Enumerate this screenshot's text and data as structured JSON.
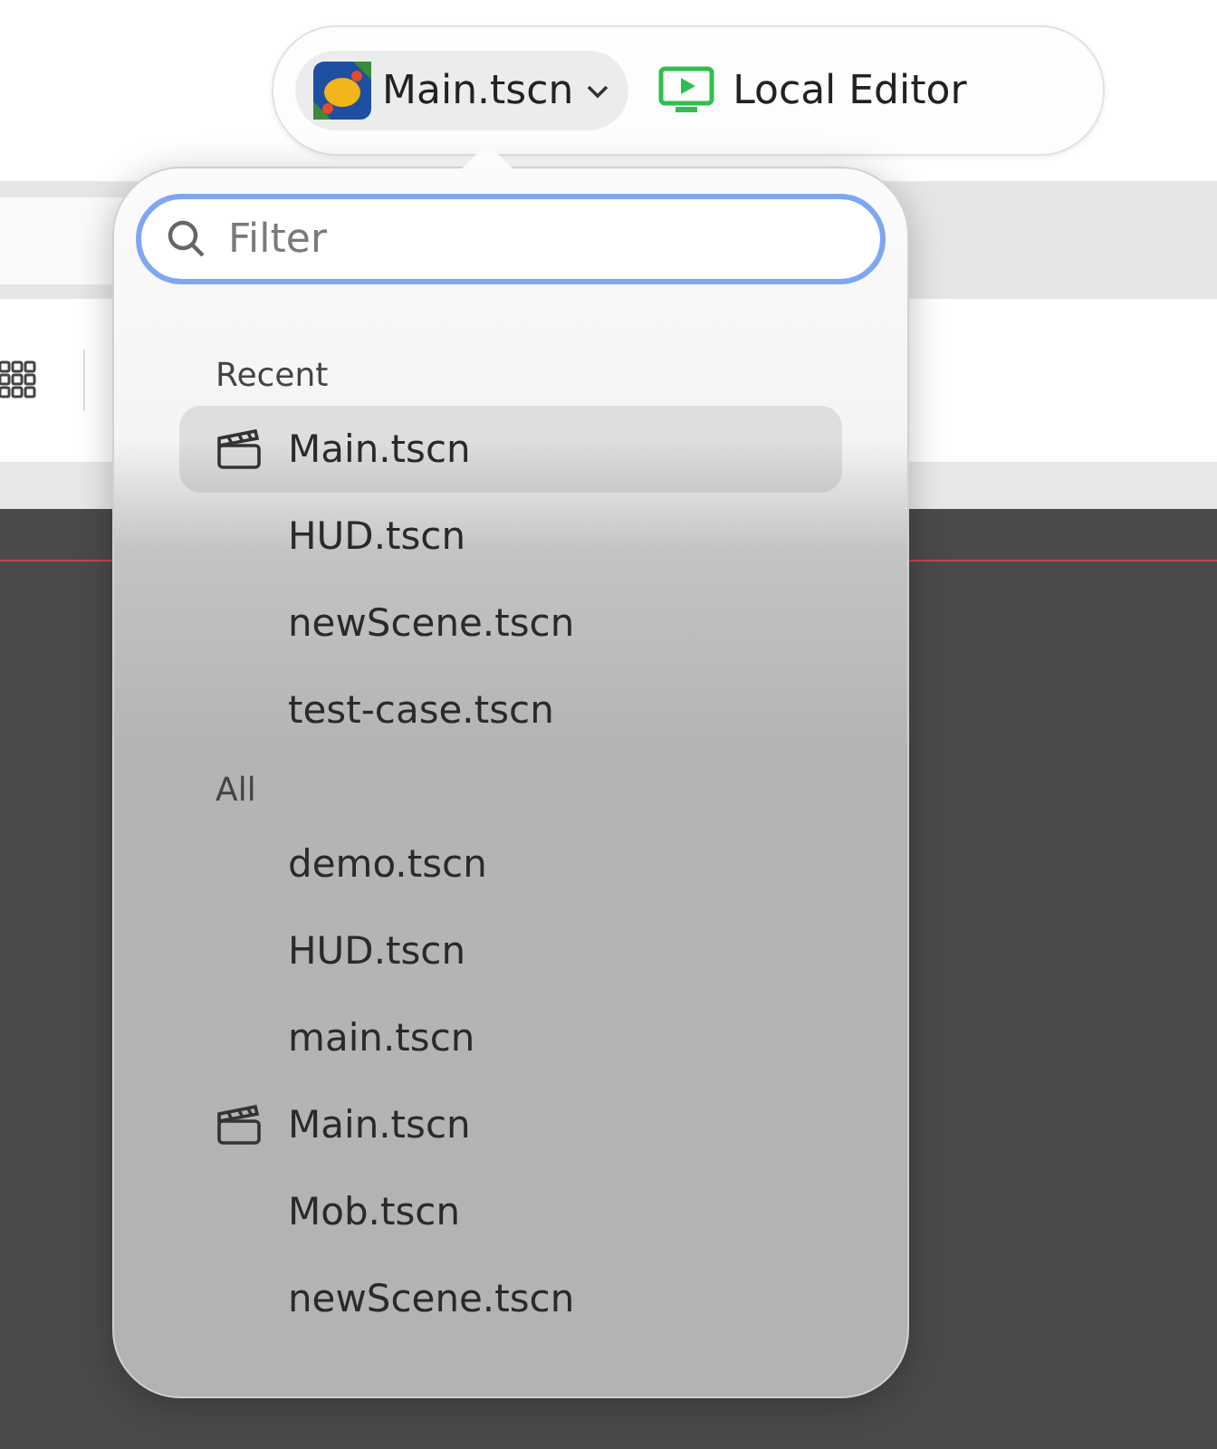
{
  "scheme_selector": {
    "scene": "Main.tscn",
    "target": "Local Editor"
  },
  "filter": {
    "placeholder": "Filter"
  },
  "sections": [
    {
      "title": "Recent",
      "items": [
        {
          "label": "Main.tscn",
          "kind": "scene",
          "selected": true
        },
        {
          "label": "HUD.tscn",
          "kind": "file",
          "selected": false
        },
        {
          "label": "newScene.tscn",
          "kind": "file",
          "selected": false
        },
        {
          "label": "test-case.tscn",
          "kind": "file",
          "selected": false
        }
      ]
    },
    {
      "title": "All",
      "items": [
        {
          "label": "demo.tscn",
          "kind": "file",
          "selected": false
        },
        {
          "label": "HUD.tscn",
          "kind": "file",
          "selected": false
        },
        {
          "label": "main.tscn",
          "kind": "file",
          "selected": false
        },
        {
          "label": "Main.tscn",
          "kind": "scene",
          "selected": false
        },
        {
          "label": "Mob.tscn",
          "kind": "file",
          "selected": false
        },
        {
          "label": "newScene.tscn",
          "kind": "file",
          "selected": false
        }
      ]
    }
  ]
}
